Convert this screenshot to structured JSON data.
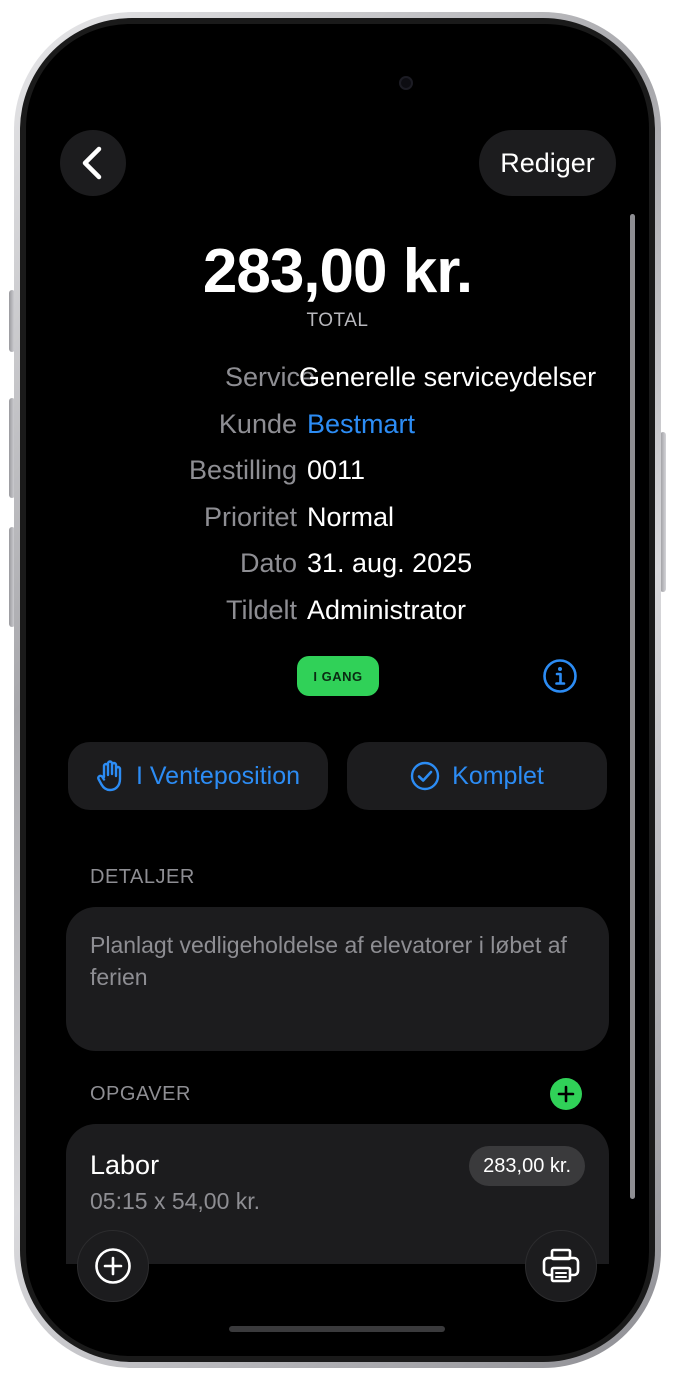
{
  "nav": {
    "edit_label": "Rediger"
  },
  "summary": {
    "total_amount": "283,00 kr.",
    "total_label": "TOTAL"
  },
  "info_rows": [
    {
      "label": "Service",
      "value": "Generelle serviceydelser"
    },
    {
      "label": "Kunde",
      "value": "Bestmart"
    },
    {
      "label": "Bestilling",
      "value": "0011"
    },
    {
      "label": "Prioritet",
      "value": "Normal"
    },
    {
      "label": "Dato",
      "value": "31. aug. 2025"
    },
    {
      "label": "Tildelt",
      "value": "Administrator"
    }
  ],
  "status": {
    "label": "I GANG",
    "color": "#30d158"
  },
  "actions": {
    "hold_label": "I Venteposition",
    "complete_label": "Komplet"
  },
  "details": {
    "header": "DETALJER",
    "text": "Planlagt vedligeholdelse af elevatorer i løbet af ferien"
  },
  "tasks": {
    "header": "OPGAVER",
    "items": [
      {
        "title": "Labor",
        "subtitle": "05:15 x 54,00 kr.",
        "price": "283,00 kr."
      }
    ]
  },
  "colors": {
    "accent": "#2c8cf4",
    "success": "#30d158",
    "background": "#000000",
    "card": "#1c1c1e"
  },
  "icons": {
    "back": "chevron-left-icon",
    "info": "info-circle-icon",
    "hold": "hand-raised-icon",
    "complete": "checkmark-circle-icon",
    "add_task": "plus-icon",
    "add": "plus-circle-icon",
    "print": "printer-icon"
  }
}
